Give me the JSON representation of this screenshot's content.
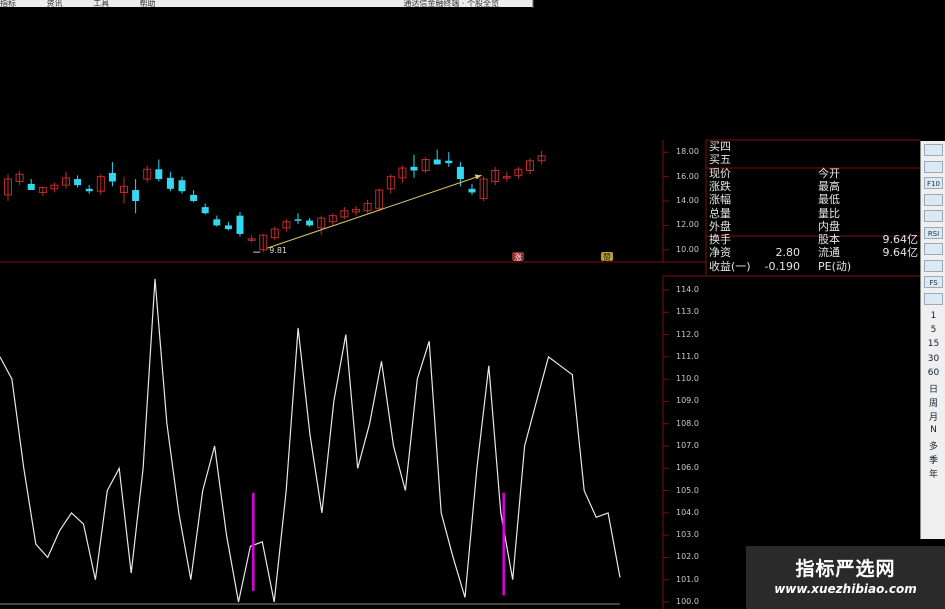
{
  "top_bar": {
    "items": [
      "指标",
      "资讯",
      "工具",
      "帮助"
    ],
    "right_text": "通达信金融终端 · 个股全览"
  },
  "colors": {
    "up": "#c22b2b",
    "down": "#35d6f0",
    "axis_red": "#7a1010",
    "indicator_line": "#e8e8e8",
    "signal": "#e000e0",
    "arrow": "#d8c868"
  },
  "price_chart": {
    "low_label": "9.81",
    "markers": [
      "涨",
      "赞"
    ],
    "y_ticks": [
      "18.00",
      "16.00",
      "14.00",
      "12.00",
      "10.00"
    ],
    "candles": [
      {
        "o": 14.5,
        "h": 16.2,
        "l": 14.0,
        "c": 15.8
      },
      {
        "o": 15.6,
        "h": 16.5,
        "l": 15.3,
        "c": 16.2
      },
      {
        "o": 15.4,
        "h": 15.8,
        "l": 14.9,
        "c": 14.9
      },
      {
        "o": 14.7,
        "h": 15.2,
        "l": 14.4,
        "c": 15.1
      },
      {
        "o": 15.0,
        "h": 15.5,
        "l": 14.7,
        "c": 15.3
      },
      {
        "o": 15.3,
        "h": 16.4,
        "l": 15.0,
        "c": 15.9
      },
      {
        "o": 15.8,
        "h": 16.1,
        "l": 15.1,
        "c": 15.3
      },
      {
        "o": 15.0,
        "h": 15.3,
        "l": 14.6,
        "c": 14.8
      },
      {
        "o": 14.8,
        "h": 16.2,
        "l": 14.5,
        "c": 16.0
      },
      {
        "o": 16.3,
        "h": 17.2,
        "l": 15.2,
        "c": 15.6
      },
      {
        "o": 14.7,
        "h": 16.0,
        "l": 13.8,
        "c": 15.2
      },
      {
        "o": 14.9,
        "h": 15.8,
        "l": 13.0,
        "c": 14.0
      },
      {
        "o": 15.8,
        "h": 16.9,
        "l": 15.5,
        "c": 16.6
      },
      {
        "o": 16.6,
        "h": 17.4,
        "l": 15.6,
        "c": 15.8
      },
      {
        "o": 15.9,
        "h": 16.4,
        "l": 14.8,
        "c": 15.0
      },
      {
        "o": 15.7,
        "h": 16.0,
        "l": 14.6,
        "c": 14.8
      },
      {
        "o": 14.5,
        "h": 14.9,
        "l": 13.9,
        "c": 14.0
      },
      {
        "o": 13.5,
        "h": 13.8,
        "l": 12.9,
        "c": 13.0
      },
      {
        "o": 12.5,
        "h": 12.8,
        "l": 11.9,
        "c": 12.0
      },
      {
        "o": 12.0,
        "h": 12.3,
        "l": 11.6,
        "c": 11.7
      },
      {
        "o": 12.8,
        "h": 13.1,
        "l": 11.1,
        "c": 11.3
      },
      {
        "o": 10.9,
        "h": 11.2,
        "l": 10.6,
        "c": 10.9
      },
      {
        "o": 10.0,
        "h": 11.3,
        "l": 9.81,
        "c": 11.2
      },
      {
        "o": 11.0,
        "h": 11.9,
        "l": 10.8,
        "c": 11.7
      },
      {
        "o": 11.8,
        "h": 12.5,
        "l": 11.5,
        "c": 12.3
      },
      {
        "o": 12.5,
        "h": 13.0,
        "l": 12.1,
        "c": 12.4
      },
      {
        "o": 12.4,
        "h": 12.6,
        "l": 11.9,
        "c": 12.0
      },
      {
        "o": 11.8,
        "h": 12.8,
        "l": 11.2,
        "c": 12.6
      },
      {
        "o": 12.3,
        "h": 13.0,
        "l": 12.0,
        "c": 12.8
      },
      {
        "o": 12.7,
        "h": 13.5,
        "l": 12.5,
        "c": 13.2
      },
      {
        "o": 13.1,
        "h": 13.6,
        "l": 12.8,
        "c": 13.3
      },
      {
        "o": 13.2,
        "h": 14.1,
        "l": 13.0,
        "c": 13.8
      },
      {
        "o": 13.4,
        "h": 15.0,
        "l": 13.2,
        "c": 14.9
      },
      {
        "o": 15.0,
        "h": 16.2,
        "l": 14.6,
        "c": 16.0
      },
      {
        "o": 15.9,
        "h": 16.9,
        "l": 15.5,
        "c": 16.7
      },
      {
        "o": 16.8,
        "h": 17.8,
        "l": 15.9,
        "c": 16.5
      },
      {
        "o": 16.5,
        "h": 17.6,
        "l": 16.3,
        "c": 17.4
      },
      {
        "o": 17.4,
        "h": 18.2,
        "l": 17.0,
        "c": 17.0
      },
      {
        "o": 17.3,
        "h": 18.0,
        "l": 16.8,
        "c": 17.1
      },
      {
        "o": 16.8,
        "h": 17.2,
        "l": 15.2,
        "c": 15.8
      },
      {
        "o": 15.0,
        "h": 15.4,
        "l": 14.5,
        "c": 14.7
      },
      {
        "o": 14.2,
        "h": 16.0,
        "l": 14.0,
        "c": 15.8
      },
      {
        "o": 15.6,
        "h": 16.8,
        "l": 15.3,
        "c": 16.5
      },
      {
        "o": 15.9,
        "h": 16.4,
        "l": 15.6,
        "c": 16.0
      },
      {
        "o": 16.1,
        "h": 16.8,
        "l": 15.8,
        "c": 16.6
      },
      {
        "o": 16.5,
        "h": 17.5,
        "l": 16.2,
        "c": 17.3
      },
      {
        "o": 17.3,
        "h": 18.1,
        "l": 17.0,
        "c": 17.7
      }
    ]
  },
  "quote_panel": {
    "rows": [
      {
        "k1": "买四",
        "v1": "",
        "k2": "",
        "v2": ""
      },
      {
        "k1": "买五",
        "v1": "",
        "k2": "",
        "v2": ""
      },
      {
        "k1": "现价",
        "v1": "",
        "k2": "今开",
        "v2": ""
      },
      {
        "k1": "涨跌",
        "v1": "",
        "k2": "最高",
        "v2": ""
      },
      {
        "k1": "涨幅",
        "v1": "",
        "k2": "最低",
        "v2": ""
      },
      {
        "k1": "总量",
        "v1": "",
        "k2": "量比",
        "v2": ""
      },
      {
        "k1": "外盘",
        "v1": "",
        "k2": "内盘",
        "v2": ""
      },
      {
        "k1": "换手",
        "v1": "",
        "k2": "股本",
        "v2": "9.64亿"
      },
      {
        "k1": "净资",
        "v1": "2.80",
        "k2": "流通",
        "v2": "9.64亿"
      },
      {
        "k1": "收益(一)",
        "v1": "-0.190",
        "k2": "PE(动)",
        "v2": ""
      }
    ]
  },
  "indicator": {
    "y_ticks": [
      "114.0",
      "113.0",
      "112.0",
      "111.0",
      "110.0",
      "109.0",
      "108.0",
      "107.0",
      "106.0",
      "105.0",
      "104.0",
      "103.0",
      "102.0",
      "101.0",
      "100.0"
    ],
    "ylim": [
      100,
      114
    ],
    "series": [
      111,
      110,
      106,
      102.6,
      102,
      103.2,
      104,
      103.5,
      101,
      105,
      106,
      101.3,
      106,
      114.5,
      108,
      104,
      101,
      105,
      107,
      103,
      100,
      102.5,
      102.7,
      100,
      105,
      112.3,
      107.5,
      104,
      109,
      112,
      106,
      108,
      110.8,
      107,
      105,
      110,
      111.7,
      104,
      102,
      100.2,
      106,
      110.6,
      104,
      101,
      107,
      109,
      111,
      110.6,
      110.2,
      105,
      103.8,
      104,
      101.1
    ],
    "signals": [
      {
        "index": 22,
        "top": 104.9,
        "bottom": 100.5
      },
      {
        "index": 43,
        "top": 104.9,
        "bottom": 100.3
      }
    ]
  },
  "right_toolbar": {
    "icons": [
      "chart-icon",
      "grid-icon",
      "f10-icon",
      "window-icon",
      "ruler-icon",
      "rsi-icon",
      "move-icon",
      "pencil-icon",
      "fs-icon",
      "settings-icon"
    ],
    "icon_labels": [
      "",
      "",
      "F10",
      "",
      "",
      "RSI",
      "",
      "",
      "FS",
      ""
    ],
    "periods": [
      "1",
      "5",
      "15",
      "30",
      "60",
      "日",
      "周",
      "月",
      "N",
      "多",
      "季",
      "年"
    ]
  },
  "watermark": {
    "title": "指标严选网",
    "url": "www.xuezhibiao.com"
  }
}
